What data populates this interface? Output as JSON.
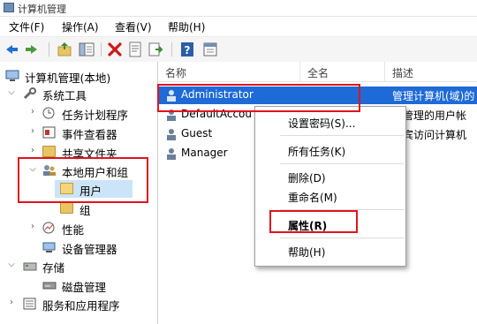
{
  "window": {
    "title": "计算机管理"
  },
  "menu": [
    "文件(F)",
    "操作(A)",
    "查看(V)",
    "帮助(H)"
  ],
  "tree": {
    "root": "计算机管理(本地)",
    "system_tools": "系统工具",
    "task_scheduler": "任务计划程序",
    "event_viewer": "事件查看器",
    "shared_folders": "共享文件夹",
    "local_users_groups": "本地用户和组",
    "users": "用户",
    "groups": "组",
    "performance": "性能",
    "device_manager": "设备管理器",
    "storage": "存储",
    "disk_management": "磁盘管理",
    "services_apps": "服务和应用程序"
  },
  "list": {
    "columns": [
      "名称",
      "全名",
      "描述"
    ],
    "rows": [
      {
        "name": "Administrator",
        "fullname": "",
        "desc": "管理计算机(域)的"
      },
      {
        "name": "DefaultAccou",
        "fullname": "",
        "desc": "统管理的用户帐"
      },
      {
        "name": "Guest",
        "fullname": "",
        "desc": "来宾访问计算机"
      },
      {
        "name": "Manager",
        "fullname": "",
        "desc": ""
      }
    ]
  },
  "context_menu": {
    "set_password": "设置密码(S)...",
    "all_tasks": "所有任务(K)",
    "delete": "删除(D)",
    "rename": "重命名(M)",
    "properties": "属性(R)",
    "help": "帮助(H)"
  },
  "colors": {
    "highlight": "#1e6ad6",
    "annotation": "#e1141c"
  }
}
